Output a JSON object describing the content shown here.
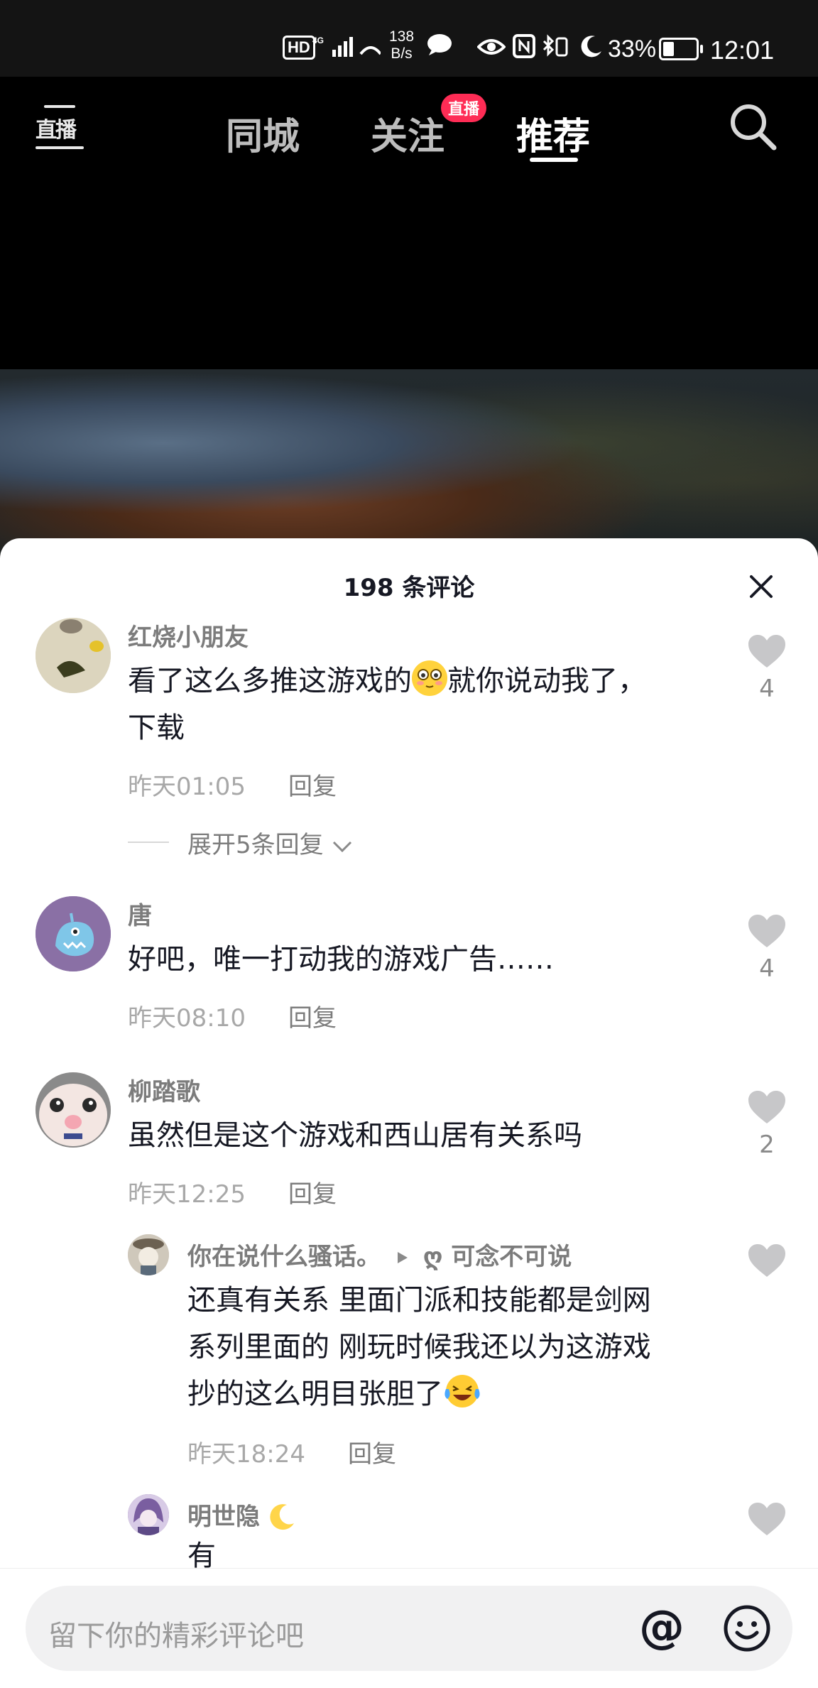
{
  "status_bar": {
    "hd": "HD",
    "network": "4G",
    "speed_value": "138",
    "speed_unit": "B/s",
    "battery_percent": "33%",
    "battery_level": 0.33,
    "time": "12:01"
  },
  "top_nav": {
    "live_icon_label": "直播",
    "tabs": [
      {
        "label": "同城",
        "active": false
      },
      {
        "label": "关注",
        "active": false
      },
      {
        "label": "推荐",
        "active": true
      }
    ],
    "live_badge": "直播"
  },
  "comments_sheet": {
    "title": "198 条评论",
    "comments": [
      {
        "user": "红烧小朋友",
        "text_before_emoji": "看了这么多推这游戏的",
        "text_after_emoji": "就你说动我了，",
        "text_line2": "下载",
        "time": "昨天01:05",
        "reply_label": "回复",
        "likes": "4",
        "expand_label": "展开5条回复"
      },
      {
        "user": "唐",
        "text": "好吧，唯一打动我的游戏广告……",
        "time": "昨天08:10",
        "reply_label": "回复",
        "likes": "4"
      },
      {
        "user": "柳踏歌",
        "text": "虽然但是这个游戏和西山居有关系吗",
        "time": "昨天12:25",
        "reply_label": "回复",
        "likes": "2",
        "replies": [
          {
            "user": "你在说什么骚话。",
            "reply_to": "ღ 可念不可说",
            "text_line1": "还真有关系 里面门派和技能都是剑网",
            "text_line2": "系列里面的 刚玩时候我还以为这游戏",
            "text_line3": "抄的这么明目张胆了",
            "time": "昨天18:24",
            "reply_label": "回复"
          },
          {
            "user": "明世隐",
            "text": "有"
          }
        ]
      }
    ]
  },
  "input": {
    "placeholder": "留下你的精彩评论吧",
    "at_symbol": "@"
  },
  "colors": {
    "accent": "#fe2c55",
    "heart": "#c7c7c9",
    "text": "#161823",
    "muted": "#a8a8a8"
  }
}
